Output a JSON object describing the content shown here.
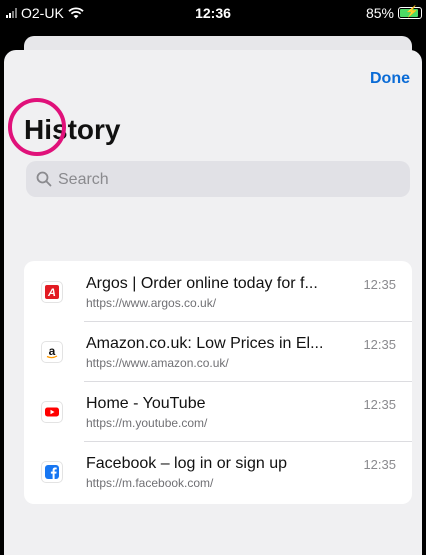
{
  "status_bar": {
    "carrier": "O2-UK",
    "time": "12:36",
    "battery_percent": "85%"
  },
  "header": {
    "done_label": "Done",
    "title": "History"
  },
  "search": {
    "placeholder": "Search"
  },
  "history": [
    {
      "title": "Argos | Order online today for f...",
      "url": "https://www.argos.co.uk/",
      "time": "12:35",
      "icon": "argos-icon"
    },
    {
      "title": "Amazon.co.uk: Low Prices in El...",
      "url": "https://www.amazon.co.uk/",
      "time": "12:35",
      "icon": "amazon-icon"
    },
    {
      "title": "Home - YouTube",
      "url": "https://m.youtube.com/",
      "time": "12:35",
      "icon": "youtube-icon"
    },
    {
      "title": "Facebook – log in or sign up",
      "url": "https://m.facebook.com/",
      "time": "12:35",
      "icon": "facebook-icon"
    }
  ],
  "colors": {
    "accent": "#0a6bd6",
    "highlight": "#e0117a"
  }
}
